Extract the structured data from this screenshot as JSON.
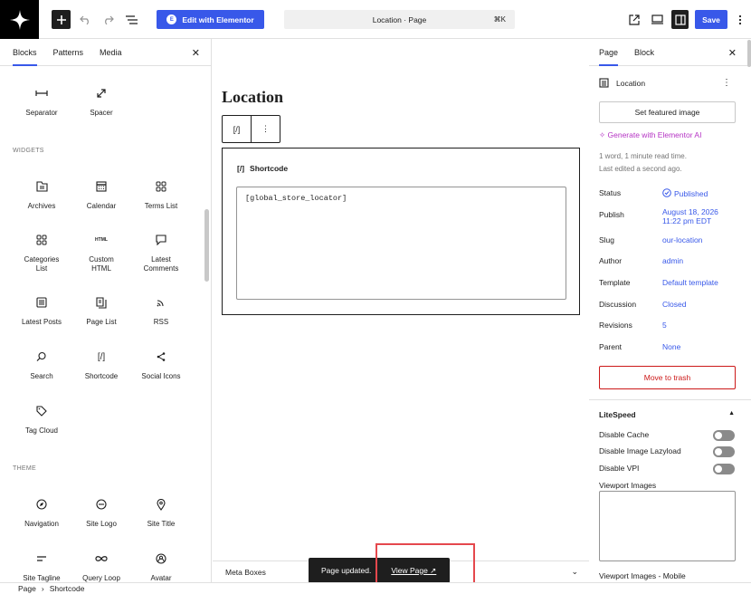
{
  "topbar": {
    "elementor_label": "Edit with Elementor",
    "command_title": "Location · Page",
    "command_shortcut": "⌘K",
    "save_label": "Save"
  },
  "inserter": {
    "tabs": [
      "Blocks",
      "Patterns",
      "Media"
    ],
    "design_blocks": [
      {
        "label": "Separator",
        "icon": "separator-icon"
      },
      {
        "label": "Spacer",
        "icon": "spacer-icon"
      }
    ],
    "widgets_heading": "WIDGETS",
    "widgets": [
      {
        "label": "Archives",
        "icon": "archives-icon"
      },
      {
        "label": "Calendar",
        "icon": "calendar-icon"
      },
      {
        "label": "Terms List",
        "icon": "terms-list-icon"
      },
      {
        "label": "Categories\nList",
        "icon": "categories-list-icon"
      },
      {
        "label": "Custom\nHTML",
        "icon": "custom-html-icon",
        "icon_text": "HTML"
      },
      {
        "label": "Latest\nComments",
        "icon": "latest-comments-icon"
      },
      {
        "label": "Latest Posts",
        "icon": "latest-posts-icon"
      },
      {
        "label": "Page List",
        "icon": "page-list-icon"
      },
      {
        "label": "RSS",
        "icon": "rss-icon"
      },
      {
        "label": "Search",
        "icon": "search-icon"
      },
      {
        "label": "Shortcode",
        "icon": "shortcode-icon"
      },
      {
        "label": "Social Icons",
        "icon": "social-icons-icon"
      },
      {
        "label": "Tag Cloud",
        "icon": "tag-cloud-icon"
      }
    ],
    "theme_heading": "THEME",
    "theme": [
      {
        "label": "Navigation",
        "icon": "navigation-icon"
      },
      {
        "label": "Site Logo",
        "icon": "site-logo-icon"
      },
      {
        "label": "Site Title",
        "icon": "site-title-icon"
      },
      {
        "label": "Site Tagline",
        "icon": "site-tagline-icon"
      },
      {
        "label": "Query Loop",
        "icon": "query-loop-icon"
      },
      {
        "label": "Avatar",
        "icon": "avatar-icon"
      }
    ]
  },
  "canvas": {
    "page_title": "Location",
    "toolbar_shortcode_glyph": "[/]",
    "toolbar_more_glyph": "⋮",
    "shortcode_label": "Shortcode",
    "shortcode_value": "[global_store_locator]",
    "meta_boxes_label": "Meta Boxes"
  },
  "snackbar": {
    "message": "Page updated.",
    "link": "View Page ↗"
  },
  "settings": {
    "tabs": [
      "Page",
      "Block"
    ],
    "doc_title": "Location",
    "featured_image_label": "Set featured image",
    "ai_label": "Generate with Elementor AI",
    "read_time": "1 word, 1 minute read time.",
    "last_edited": "Last edited a second ago.",
    "rows": [
      {
        "label": "Status",
        "value": "Published"
      },
      {
        "label": "Publish",
        "value": "August 18, 2026\n11:22 pm EDT"
      },
      {
        "label": "Slug",
        "value": "our-location"
      },
      {
        "label": "Author",
        "value": "admin"
      },
      {
        "label": "Template",
        "value": "Default template"
      },
      {
        "label": "Discussion",
        "value": "Closed"
      },
      {
        "label": "Revisions",
        "value": "5"
      },
      {
        "label": "Parent",
        "value": "None"
      }
    ],
    "trash_label": "Move to trash",
    "litespeed": {
      "title": "LiteSpeed",
      "toggles": [
        "Disable Cache",
        "Disable Image Lazyload",
        "Disable VPI"
      ],
      "viewport_images": "Viewport Images",
      "viewport_images_mobile": "Viewport Images - Mobile"
    }
  },
  "footer": {
    "breadcrumb": [
      "Page",
      "Shortcode"
    ]
  },
  "colors": {
    "accent": "#3858e9",
    "danger": "#cc1818",
    "ai": "#b533c4",
    "highlight": "#e5484d"
  }
}
